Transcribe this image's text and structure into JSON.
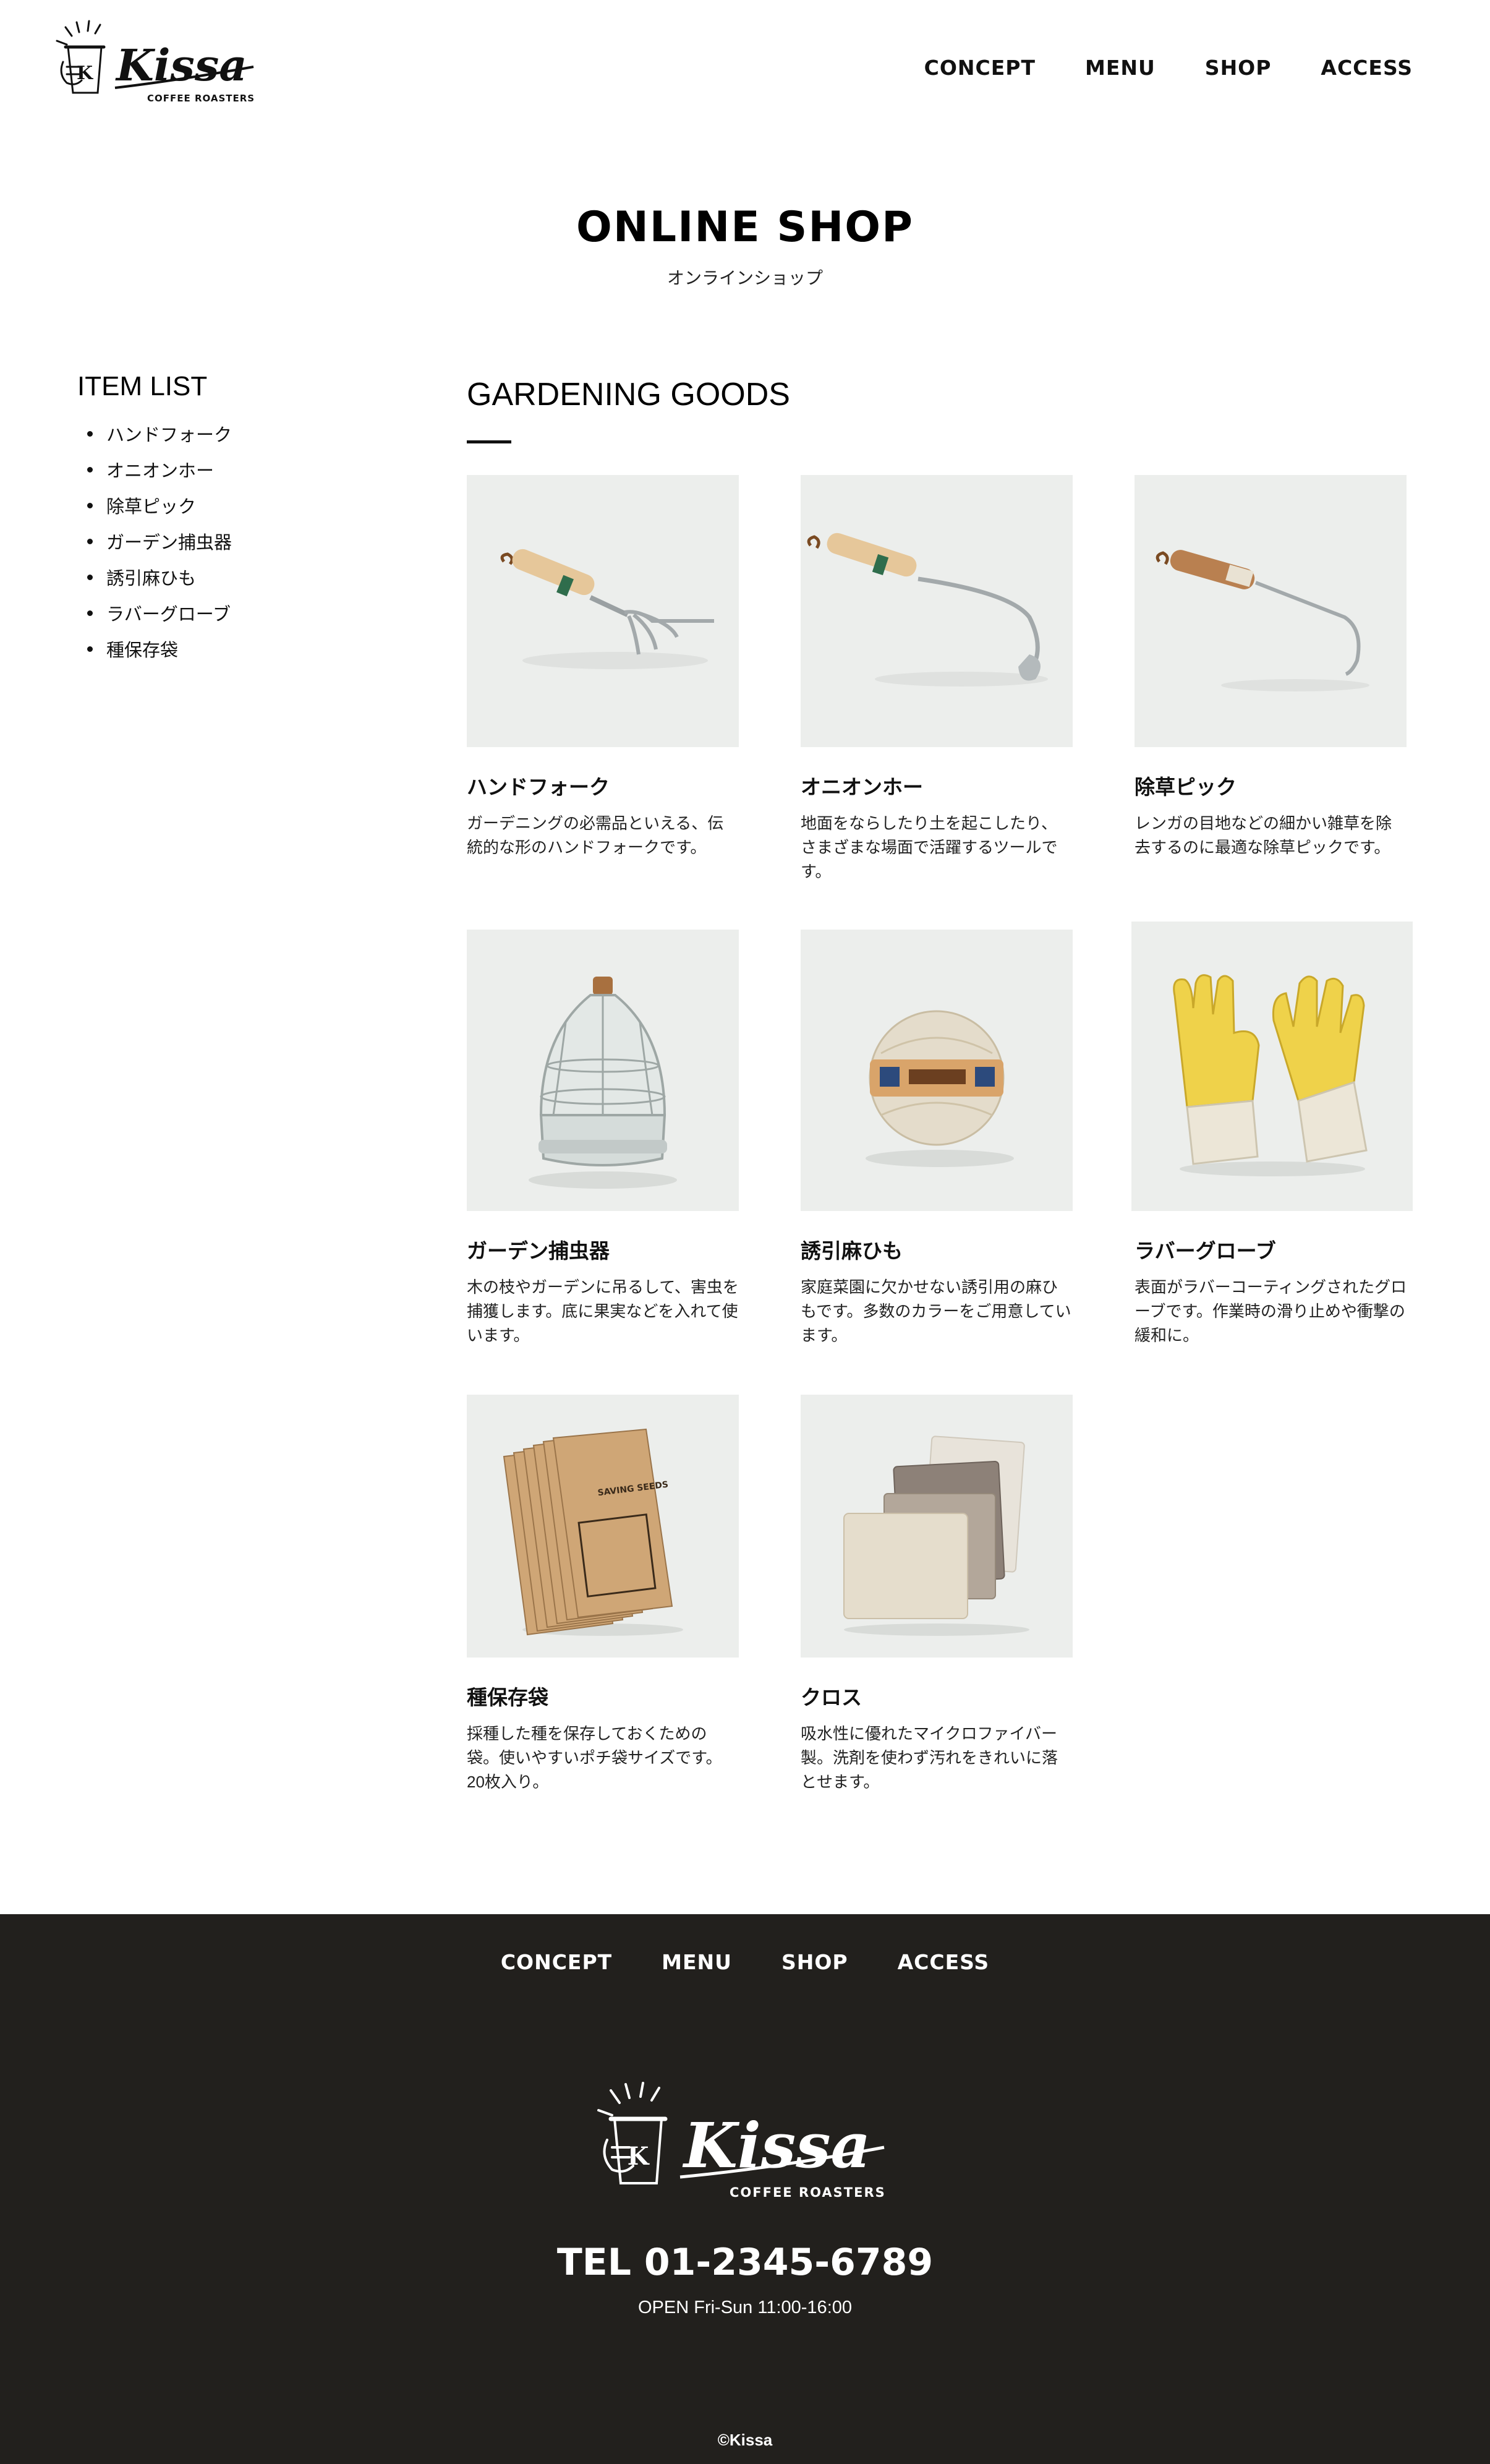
{
  "header": {
    "logo_script": "Kissa",
    "logo_sub": "COFFEE ROASTERS",
    "nav": [
      "CONCEPT",
      "MENU",
      "SHOP",
      "ACCESS"
    ]
  },
  "page": {
    "title": "ONLINE SHOP",
    "subtitle": "オンラインショップ"
  },
  "sidebar": {
    "title": "ITEM LIST",
    "items": [
      "ハンドフォーク",
      "オニオンホー",
      "除草ピック",
      "ガーデン捕虫器",
      "誘引麻ひも",
      "ラバーグローブ",
      "種保存袋"
    ]
  },
  "main": {
    "title": "GARDENING GOODS",
    "products": [
      {
        "name": "ハンドフォーク",
        "description": "ガーデニングの必需品といえる、伝統的な形のハンドフォークです。",
        "icon": "hand-fork-photo"
      },
      {
        "name": "オニオンホー",
        "description": "地面をならしたり土を起こしたり、さまざまな場面で活躍するツールです。",
        "icon": "onion-hoe-photo"
      },
      {
        "name": "除草ピック",
        "description": "レンガの目地などの細かい雑草を除去するのに最適な除草ピックです。",
        "icon": "weeding-pick-photo"
      },
      {
        "name": "ガーデン捕虫器",
        "description": "木の枝やガーデンに吊るして、害虫を捕獲します。底に果実などを入れて使います。",
        "icon": "insect-trap-photo"
      },
      {
        "name": "誘引麻ひも",
        "description": "家庭菜園に欠かせない誘引用の麻ひもです。多数のカラーをご用意しています。",
        "icon": "twine-ball-photo"
      },
      {
        "name": "ラバーグローブ",
        "description": "表面がラバーコーティングされたグローブです。作業時の滑り止めや衝撃の緩和に。",
        "icon": "rubber-gloves-photo"
      },
      {
        "name": "種保存袋",
        "description": "採種した種を保存しておくための袋。使いやすいポチ袋サイズです。20枚入り。",
        "icon": "seed-bags-photo"
      },
      {
        "name": "クロス",
        "description": "吸水性に優れたマイクロファイバー製。洗剤を使わず汚れをきれいに落とせます。",
        "icon": "cloth-photo"
      }
    ]
  },
  "footer": {
    "nav": [
      "CONCEPT",
      "MENU",
      "SHOP",
      "ACCESS"
    ],
    "logo_script": "Kissa",
    "logo_sub": "COFFEE ROASTERS",
    "tel": "TEL 01-2345-6789",
    "open": "OPEN Fri-Sun 11:00-16:00",
    "copyright": "©Kissa"
  },
  "colors": {
    "footer_bg": "#22201d",
    "photo_bg": "#eceeec",
    "text": "#111111"
  }
}
